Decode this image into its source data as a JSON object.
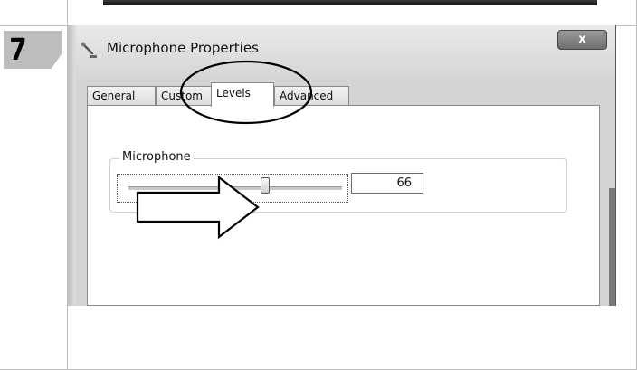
{
  "step": {
    "number": "7"
  },
  "dialog": {
    "title": "Microphone Properties",
    "close_label": "x",
    "tabs": [
      {
        "label": "General",
        "active": false
      },
      {
        "label": "Custom",
        "active": false
      },
      {
        "label": "Levels",
        "active": true
      },
      {
        "label": "Advanced",
        "active": false
      }
    ],
    "levels": {
      "group_label": "Microphone",
      "value": "66",
      "slider_level_percent": 66
    }
  },
  "annotations": {
    "highlight": "Levels tab circled",
    "arrow": "pointing to microphone slider"
  }
}
